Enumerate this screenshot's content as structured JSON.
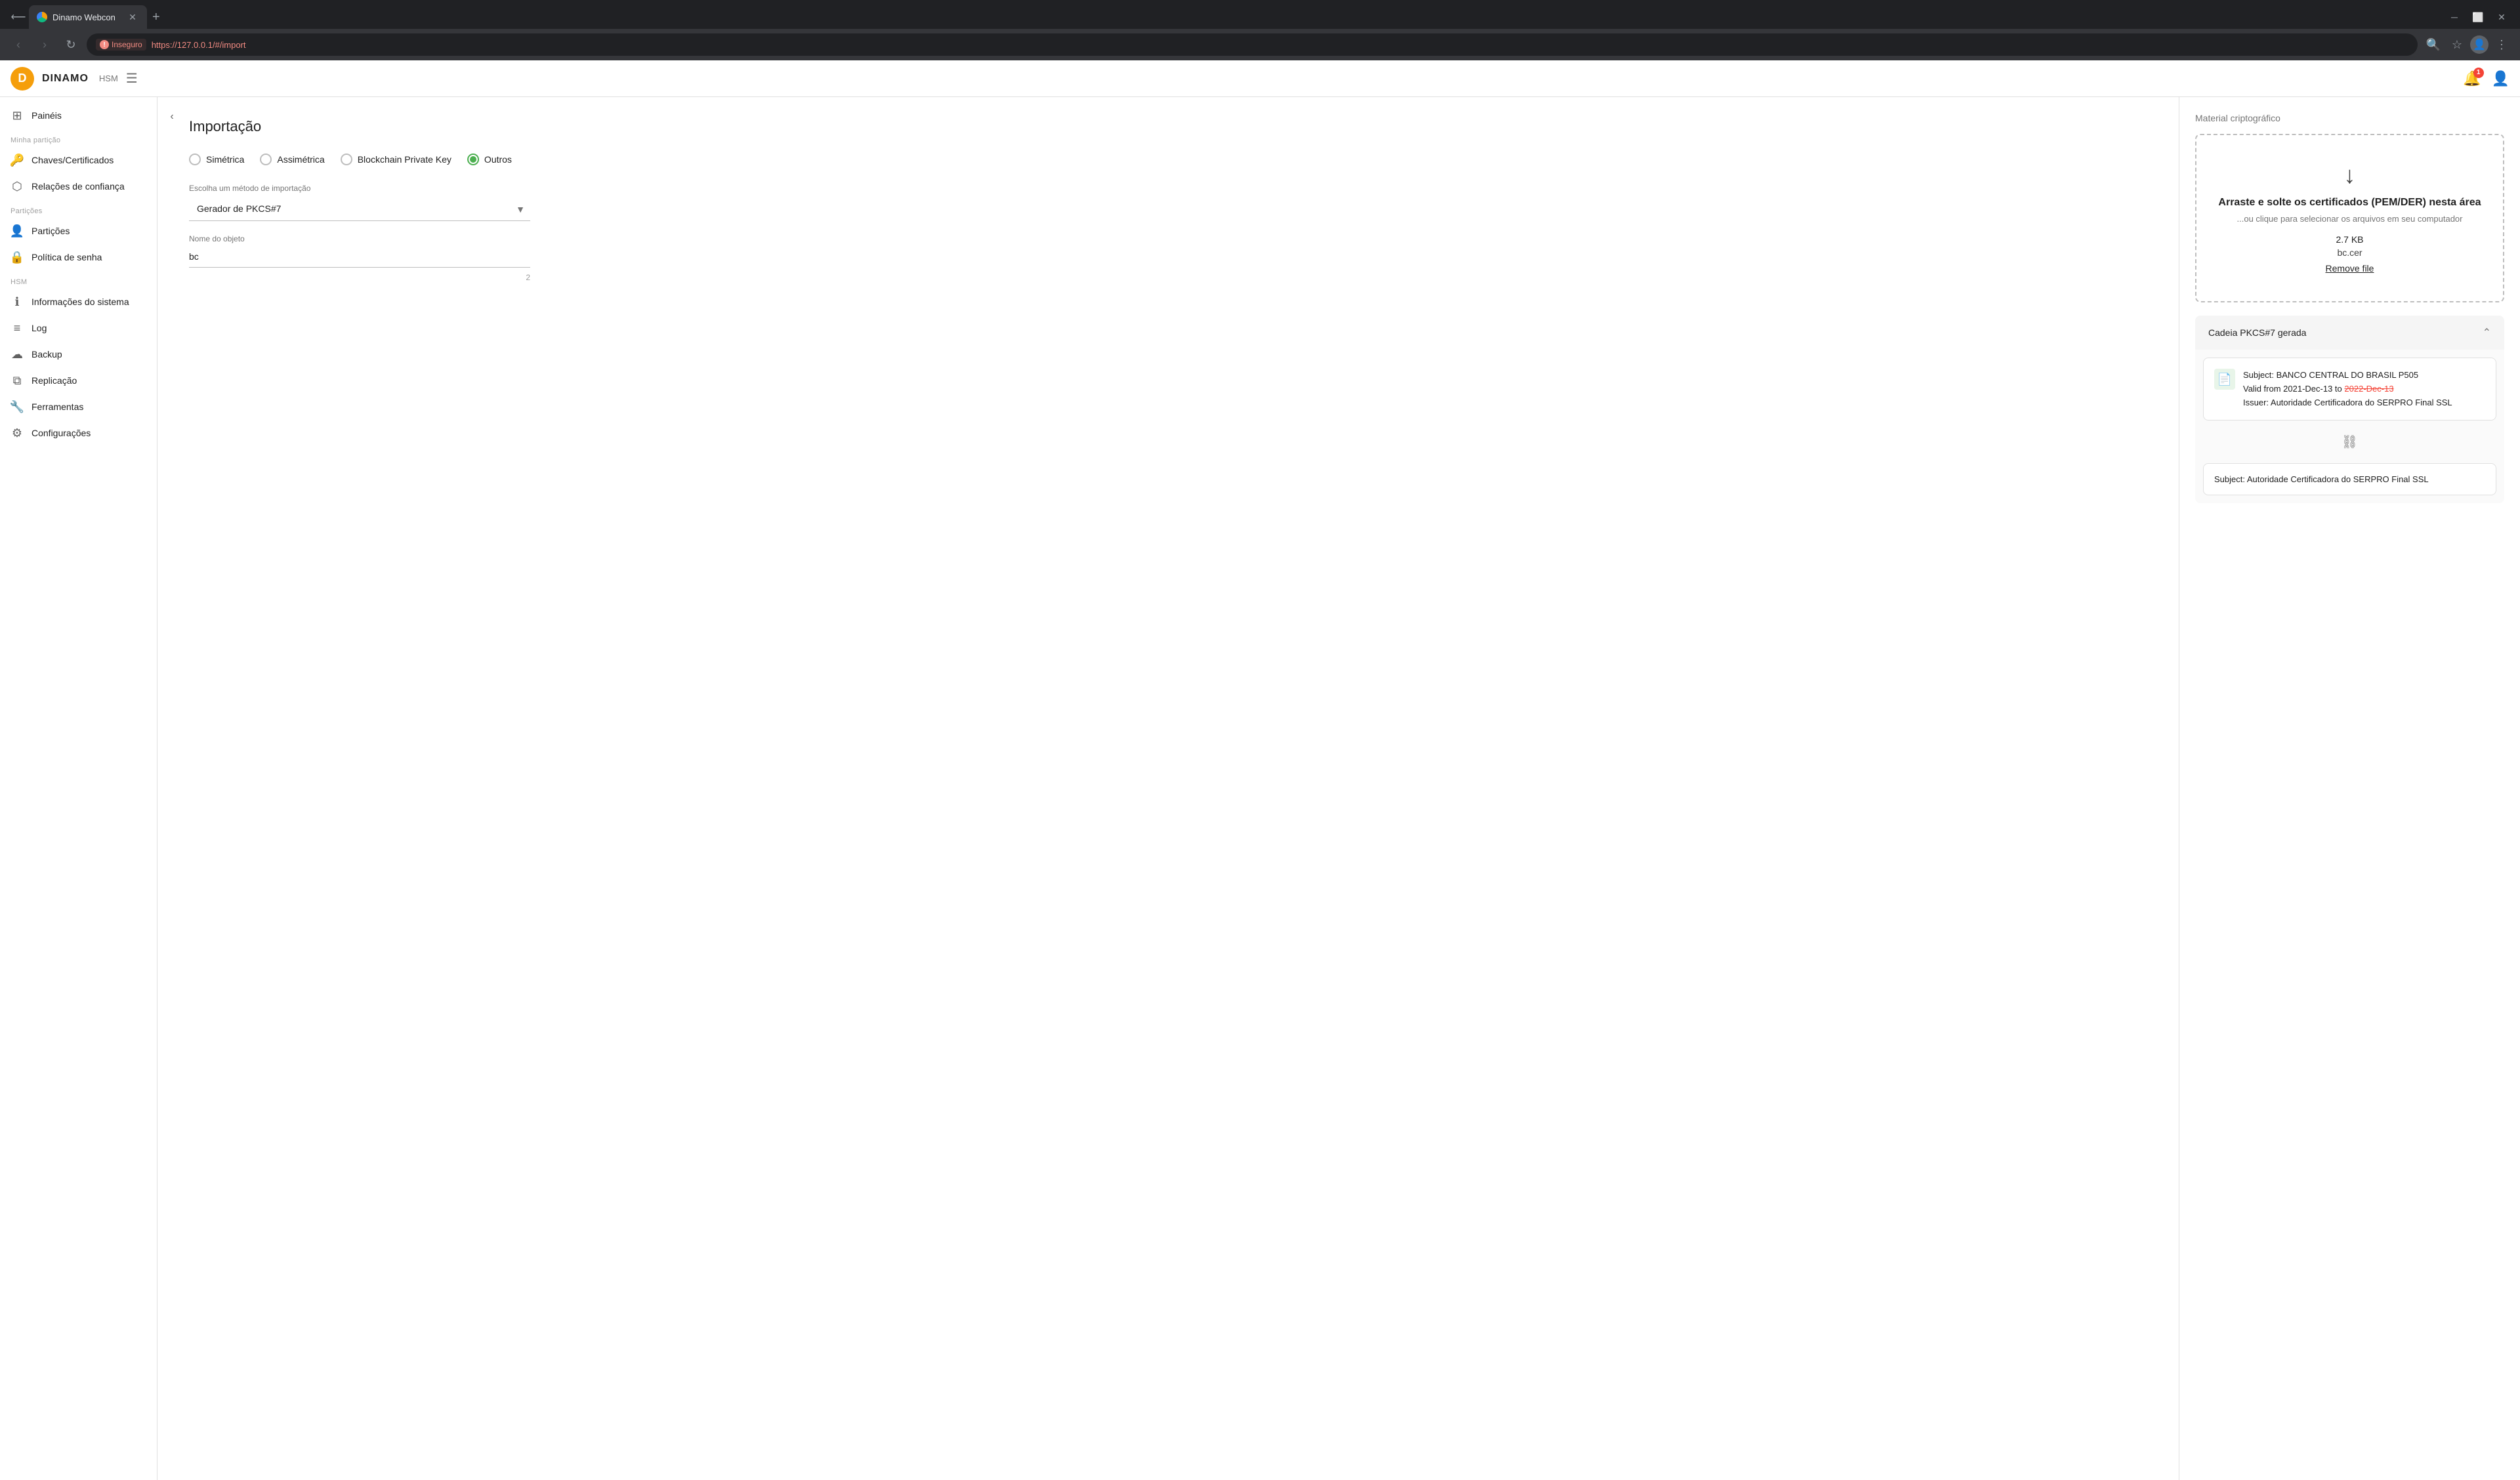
{
  "browser": {
    "tab_title": "Dinamo Webcon",
    "address": "https://127.0.0.1/#/import",
    "address_display": "https://127.0.0.1/#/import",
    "insecure_label": "Inseguro"
  },
  "topbar": {
    "logo_letter": "D",
    "app_name": "DINAMO",
    "app_sub": "HSM",
    "notification_count": "1"
  },
  "sidebar": {
    "section_minha_particao": "Minha partição",
    "section_particoes": "Partições",
    "section_hsm": "HSM",
    "items": [
      {
        "id": "paineis",
        "label": "Painéis",
        "icon": "⊞"
      },
      {
        "id": "chaves",
        "label": "Chaves/Certificados",
        "icon": "🔑"
      },
      {
        "id": "relacoes",
        "label": "Relações de confiança",
        "icon": "⬡"
      },
      {
        "id": "particoes",
        "label": "Partições",
        "icon": "👤"
      },
      {
        "id": "politica",
        "label": "Política de senha",
        "icon": "🔒"
      },
      {
        "id": "informacoes",
        "label": "Informações do sistema",
        "icon": "ℹ"
      },
      {
        "id": "log",
        "label": "Log",
        "icon": "≡"
      },
      {
        "id": "backup",
        "label": "Backup",
        "icon": "☁"
      },
      {
        "id": "replicacao",
        "label": "Replicação",
        "icon": "⧉"
      },
      {
        "id": "ferramentas",
        "label": "Ferramentas",
        "icon": "🔧"
      },
      {
        "id": "configuracoes",
        "label": "Configurações",
        "icon": "⚙"
      }
    ]
  },
  "page": {
    "title": "Importação",
    "radio_options": [
      {
        "id": "simetrica",
        "label": "Simétrica",
        "selected": false
      },
      {
        "id": "assimetrica",
        "label": "Assimétrica",
        "selected": false
      },
      {
        "id": "blockchain",
        "label": "Blockchain Private Key",
        "selected": false
      },
      {
        "id": "outros",
        "label": "Outros",
        "selected": true
      }
    ],
    "import_method_label": "Escolha um método de importação",
    "import_method_value": "Gerador de PKCS#7",
    "import_method_options": [
      "Gerador de PKCS#7"
    ],
    "object_name_label": "Nome do objeto",
    "object_name_value": "bc",
    "object_name_char_count": "2"
  },
  "right_panel": {
    "title": "Material criptográfico",
    "drop_title": "Arraste e solte os certificados (PEM/DER) nesta área",
    "drop_subtitle": "...ou clique para selecionar os arquivos em seu computador",
    "file_size": "2.7 KB",
    "file_name": "bc.cer",
    "remove_label": "Remove file",
    "pkcs7_section_title": "Cadeia PKCS#7 gerada",
    "cert1": {
      "subject": "Subject: BANCO CENTRAL DO BRASIL P505",
      "valid_from": "Valid from 2021-Dec-13 to",
      "valid_to": "2022-Dec-13",
      "issuer": "Issuer: Autoridade Certificadora do SERPRO Final SSL"
    },
    "cert2": {
      "subject": "Subject: Autoridade Certificadora do SERPRO Final SSL"
    }
  }
}
